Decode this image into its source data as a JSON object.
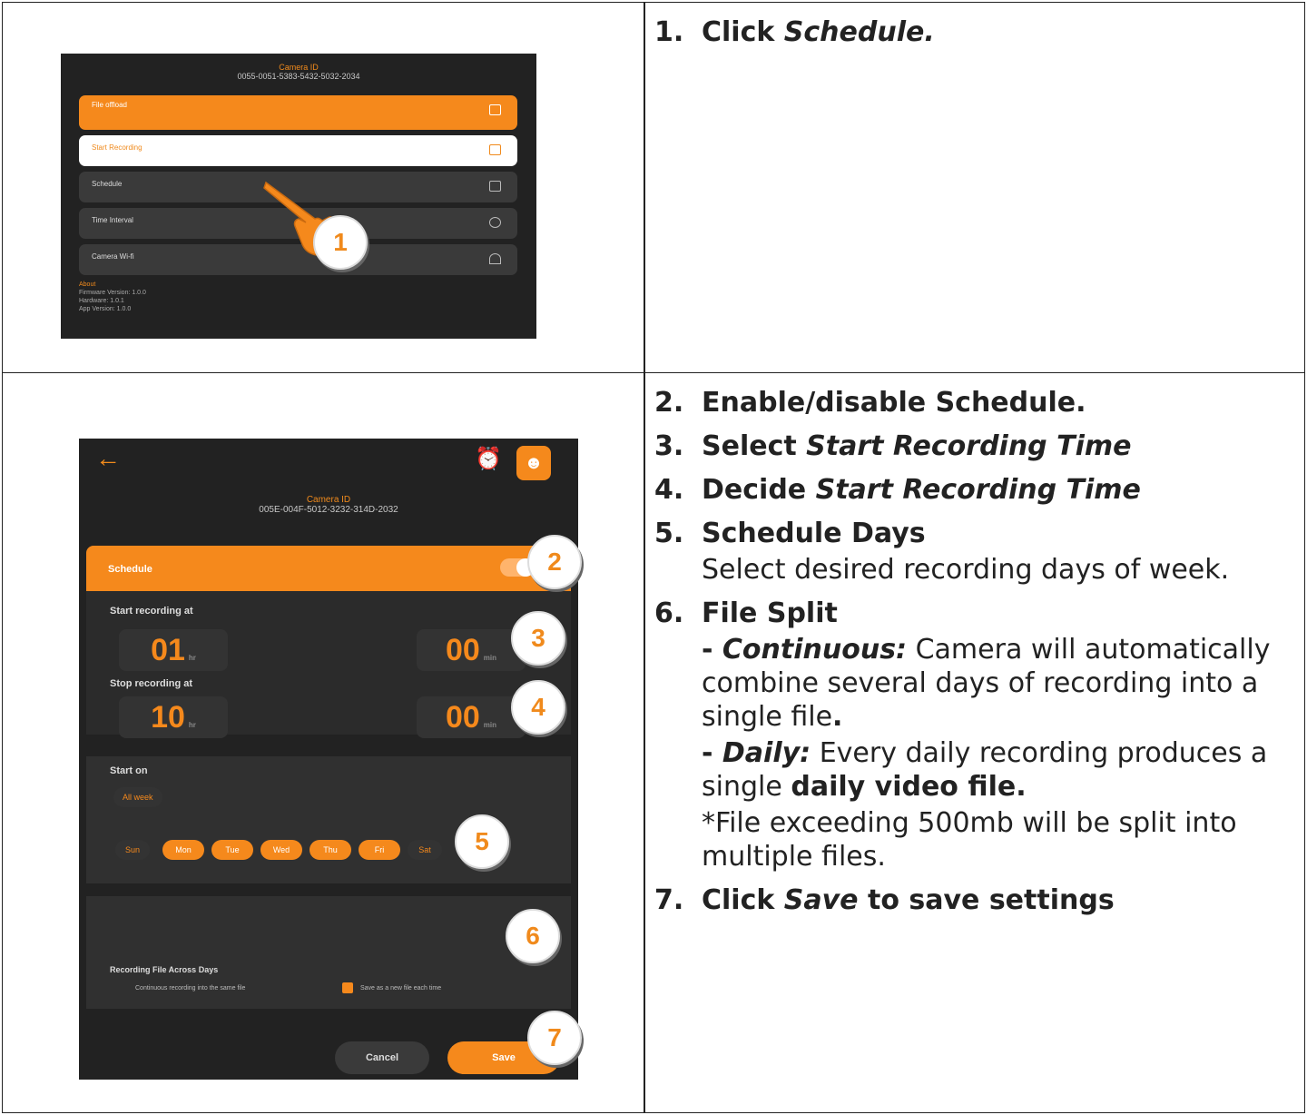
{
  "screenshot1": {
    "camera_label": "Camera ID",
    "camera_id": "0055-0051-5383-5432-5032-2034",
    "menu": [
      "File offload",
      "Start Recording",
      "Schedule",
      "Time Interval",
      "Camera Wi-fi"
    ],
    "about": [
      "About",
      "Firmware Version: 1.0.0",
      "Hardware: 1.0.1",
      "App Version: 1.0.0"
    ],
    "badge": "1"
  },
  "screenshot2": {
    "camera_label": "Camera ID",
    "camera_id": "005E-004F-5012-3232-314D-2032",
    "schedule_label": "Schedule",
    "start_label": "Start recording at",
    "start_hour": "01",
    "start_min": "00",
    "stop_label": "Stop recording at",
    "stop_hour": "10",
    "stop_min": "00",
    "hour_unit": "hr",
    "min_unit": "min",
    "start_on_label": "Start on",
    "all_week": "All week",
    "days": [
      "Sun",
      "Mon",
      "Tue",
      "Wed",
      "Thu",
      "Fri",
      "Sat"
    ],
    "file_label": "Recording File Across Days",
    "option_continuous": "Continuous recording into the same file",
    "option_new": "Save as a new file each time",
    "cancel": "Cancel",
    "save": "Save",
    "badges": [
      "2",
      "3",
      "4",
      "5",
      "6",
      "7"
    ]
  },
  "instructions": {
    "step1_num": "1.",
    "step1_a": "Click ",
    "step1_b": "Schedule.",
    "step2_num": "2.",
    "step2": "Enable/disable Schedule.",
    "step3_num": "3.",
    "step3_a": "Select ",
    "step3_b": "Start Recording Time",
    "step4_num": "4.",
    "step4_a": "Decide ",
    "step4_b": "Start Recording Time",
    "step5_num": "5.",
    "step5": "Schedule Days",
    "step5_desc": "Select desired recording days of week.",
    "step6_num": "6.",
    "step6": "File Split",
    "continuous_dash": "- ",
    "continuous_term": "Continuous:",
    "continuous_desc": " Camera will automatically combine several days of recording into a single file",
    "continuous_end": ".",
    "daily_dash": " - ",
    "daily_term": "Daily:",
    "daily_desc": " Every daily recording produces a single ",
    "daily_bold": "daily video file.",
    "note": "*File exceeding 500mb will be split into multiple files.",
    "step7_num": "7.",
    "step7_a": "Click ",
    "step7_b": "Save",
    "step7_c": " to save settings"
  }
}
